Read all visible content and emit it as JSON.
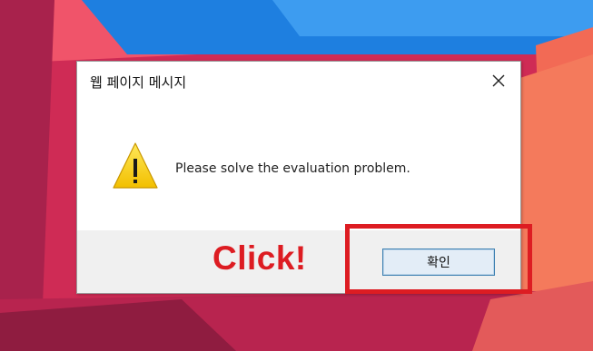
{
  "dialog": {
    "title": "웹 페이지 메시지",
    "message": "Please solve the evaluation problem.",
    "ok_label": "확인",
    "icon": "warning-icon",
    "close_icon": "close-icon"
  },
  "annotation": {
    "click_label": "Click!"
  },
  "colors": {
    "annotation_red": "#dd1c22",
    "footer_bg": "#f0f0f0",
    "button_border": "#3c7fb1",
    "warning_yellow": "#ffd200"
  }
}
